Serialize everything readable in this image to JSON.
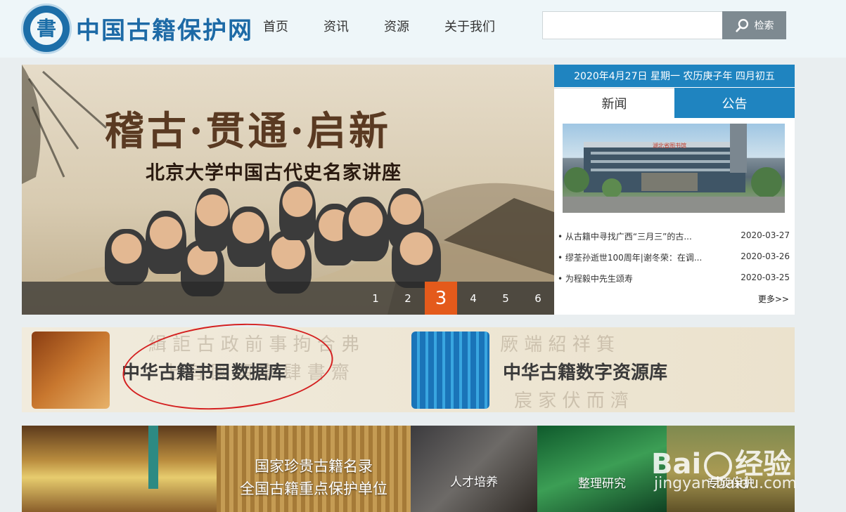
{
  "header": {
    "logo_char": "書",
    "site_title": "中国古籍保护网",
    "nav": [
      "首页",
      "资讯",
      "资源",
      "关于我们"
    ],
    "search_placeholder": "",
    "search_label": "检索"
  },
  "banner": {
    "heading": "稽古·贯通·启新",
    "subheading": "北京大学中国古代史名家讲座",
    "slides": [
      "1",
      "2",
      "3",
      "4",
      "5",
      "6"
    ],
    "active_slide": "3"
  },
  "sidebar": {
    "date": "2020年4月27日 星期一 农历庚子年 四月初五",
    "tabs": [
      "新闻",
      "公告"
    ],
    "active_tab": "新闻",
    "photo_sign": "湖北省图书馆",
    "news": [
      {
        "title": "• 从古籍中寻找广西“三月三”的古...",
        "date": "2020-03-27"
      },
      {
        "title": "• 缪荃孙逝世100周年|谢冬荣：在调...",
        "date": "2020-03-26"
      },
      {
        "title": "• 为程毅中先生颂寿",
        "date": "2020-03-25"
      }
    ],
    "more": "更多>>"
  },
  "databases": [
    {
      "title": "中华古籍书目数据库"
    },
    {
      "title": "中华古籍数字资源库"
    }
  ],
  "tiles": [
    {
      "label": ""
    },
    {
      "label": "国家珍贵古籍名录\n全国古籍重点保护单位"
    },
    {
      "label": "人才培养"
    },
    {
      "label": "整理研究"
    },
    {
      "label": "专项保护"
    }
  ],
  "watermark": {
    "brand": "Bai",
    "brand2": "经验",
    "url": "jingyan.baidu.com"
  },
  "colors": {
    "accent_blue": "#1f84c0",
    "active_slide": "#e45a1b",
    "title_blue": "#1d6aa6",
    "annotation_red": "#d42020"
  }
}
